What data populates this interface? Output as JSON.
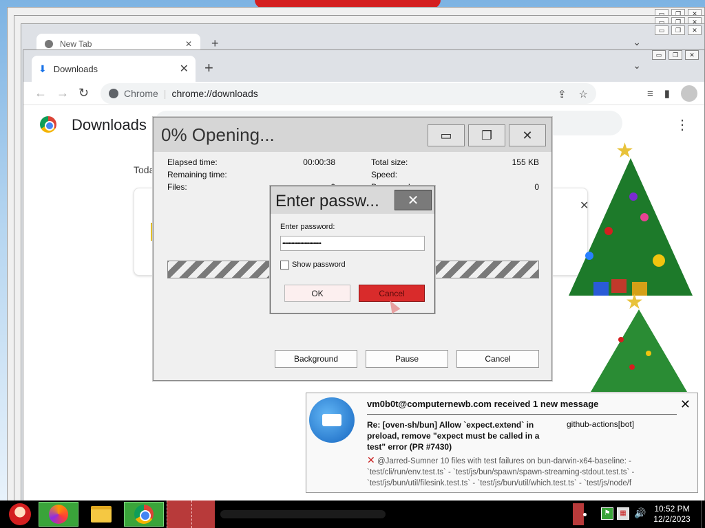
{
  "background_windows": {
    "tab_title": "New Tab",
    "tab_close": "✕",
    "new_tab": "+",
    "chevron": "⌄"
  },
  "chrome": {
    "tab": {
      "title": "Downloads",
      "close": "✕"
    },
    "new_tab": "+",
    "tab_list_chevron": "⌄",
    "window_controls": {
      "minimize": "▭",
      "restore": "❐",
      "close": "✕"
    },
    "nav": {
      "back": "←",
      "forward": "→",
      "reload": "↻"
    },
    "omnibox": {
      "site_label": "Chrome",
      "separator": "|",
      "url": "chrome://downloads"
    },
    "downloads_page": {
      "title": "Downloads",
      "section_today": "Toda",
      "menu": "⋮",
      "dismiss": "✕"
    }
  },
  "progress_dialog": {
    "title": "0% Opening...",
    "controls": {
      "minimize": "▭",
      "restore": "❐",
      "close": "✕"
    },
    "elapsed_label": "Elapsed time:",
    "elapsed_value": "00:00:38",
    "remaining_label": "Remaining time:",
    "files_label": "Files:",
    "files_value": "0",
    "total_size_label": "Total size:",
    "total_size_value": "155 KB",
    "speed_label": "Speed:",
    "processed_label": "Processed:",
    "processed_value": "0",
    "buttons": {
      "background": "Background",
      "pause": "Pause",
      "cancel": "Cancel"
    }
  },
  "password_dialog": {
    "title": "Enter passw...",
    "close": "✕",
    "label": "Enter password:",
    "masked_value": "••••••••••••••••••••••••••",
    "show_password_label": "Show password",
    "ok": "OK",
    "cancel": "Cancel"
  },
  "notification": {
    "header": "vm0b0t@computernewb.com received 1 new message",
    "close": "✕",
    "subject": "Re: [oven-sh/bun] Allow `expect.extend` in preload, remove \"expect must be called in a test\" error (PR #7430)",
    "sender": "github-actions[bot]",
    "body_icon": "✕",
    "body": "@Jarred-Sumner 10 files with test failures on bun-darwin-x64-baseline: - `test/cli/run/env.test.ts` - `test/js/bun/spawn/spawn-streaming-stdout.test.ts` - `test/js/bun/util/filesink.test.ts` - `test/js/bun/util/which.test.ts` - `test/js/node/f"
  },
  "taskbar": {
    "clock_time": "10:52 PM",
    "clock_date": "12/2/2023",
    "volume": "🔊"
  },
  "colors": {
    "chrome_blue": "#1a73e8",
    "cancel_red": "#d92b2b",
    "taskbar_green": "#3aa43a"
  }
}
